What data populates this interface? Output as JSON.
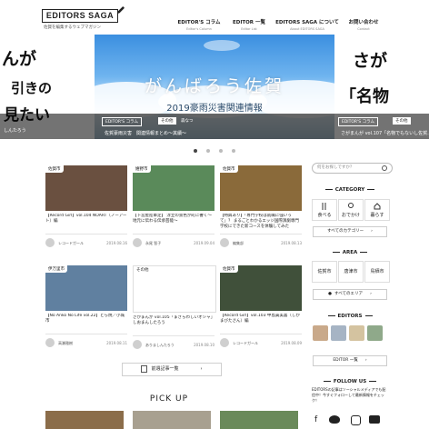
{
  "header": {
    "logo": "EDITORS SAGA",
    "tagline": "佐賀を編集するウェブマガジン",
    "nav": [
      {
        "label": "EDITOR'S コラム",
        "sub": "Editor's Column"
      },
      {
        "label": "EDITOR 一覧",
        "sub": "Editor List"
      },
      {
        "label": "EDITORS SAGA について",
        "sub": "About EDITORS SAGA"
      },
      {
        "label": "お問い合わせ",
        "sub": "Contact"
      }
    ]
  },
  "hero": {
    "left": {
      "line1": "んが",
      "line2": "引きの",
      "line3": "見たい",
      "credit": "しんたろう"
    },
    "main": {
      "headline": "がんばろう佐賀",
      "subheadline": "2019豪雨災害関連情報",
      "chip": "EDITOR'S コラム",
      "category": "その他",
      "author": "森なつ",
      "caption": "佐賀豪雨災害　関連情報まとめ〜其續〜"
    },
    "right": {
      "line1": "さが",
      "line2": "「名物",
      "chip": "EDITOR'S コラム",
      "category": "その他",
      "caption": "さがまんが vol.107「名物でもないし佐賀…"
    },
    "dots": 4,
    "active_dot": 1
  },
  "articles": [
    {
      "category": "佐賀市",
      "title": "【Record Girl】vol.104 NOART（ノーアート）編",
      "author": "レコードガール",
      "date": "2019.08.16",
      "color": "#6a5040"
    },
    {
      "category": "嬉野市",
      "title": "【下宮屋陸軍定】 淳立の景色が町に響く〜地元に伝わる伝承芸能〜",
      "author": "永尾 智子",
      "date": "2019.09.04",
      "color": "#5a8a5a"
    },
    {
      "category": "佐賀市",
      "title": "【特典あり】「専門学校は就職に強いって」？ まるごとわかるエッジ国際演劇専門学校にできた新コースを体験してみた",
      "author": "編集部",
      "date": "2019.08.13",
      "color": "#8a6a3a"
    },
    {
      "category": "伊万里市",
      "title": "【No Anko No Life vol.22】とら焼／小城市",
      "author": "高瀬雅樹",
      "date": "2019.08.11",
      "color": "#6080a0"
    },
    {
      "category": "その他",
      "title": "さがまんが vol.105「まぎらわしいオシャ」しおまんしたろう",
      "author": "ありましんたろう",
      "date": "2019.08.10",
      "color": "#ffffff"
    },
    {
      "category": "佐賀市",
      "title": "【Record Girl】vol.103 中島貴美喜（しかまびたさん）編",
      "author": "レコードガール",
      "date": "2019.08.09",
      "color": "#40503a"
    }
  ],
  "older_button": "前週記事一覧",
  "pickup_title": "PICK UP",
  "sidebar": {
    "search_placeholder": "何をお探しですか？",
    "category_title": "CATEGORY",
    "categories": [
      "食べる",
      "おでかけ",
      "暮らす"
    ],
    "all_categories": "すべてのカテゴリー",
    "area_title": "AREA",
    "areas": [
      "佐賀市",
      "唐津市",
      "鳥栖市"
    ],
    "all_areas": "すべてのエリア",
    "editors_title": "EDITORS",
    "editor_list": "EDITOR 一覧",
    "follow_title": "FOLLOW US",
    "follow_text": "EDITORSの記事はソーシャルメディアでも配信中！今すぐフォローして最新情報をチェック！",
    "social": [
      "facebook",
      "twitter",
      "instagram",
      "youtube"
    ]
  }
}
